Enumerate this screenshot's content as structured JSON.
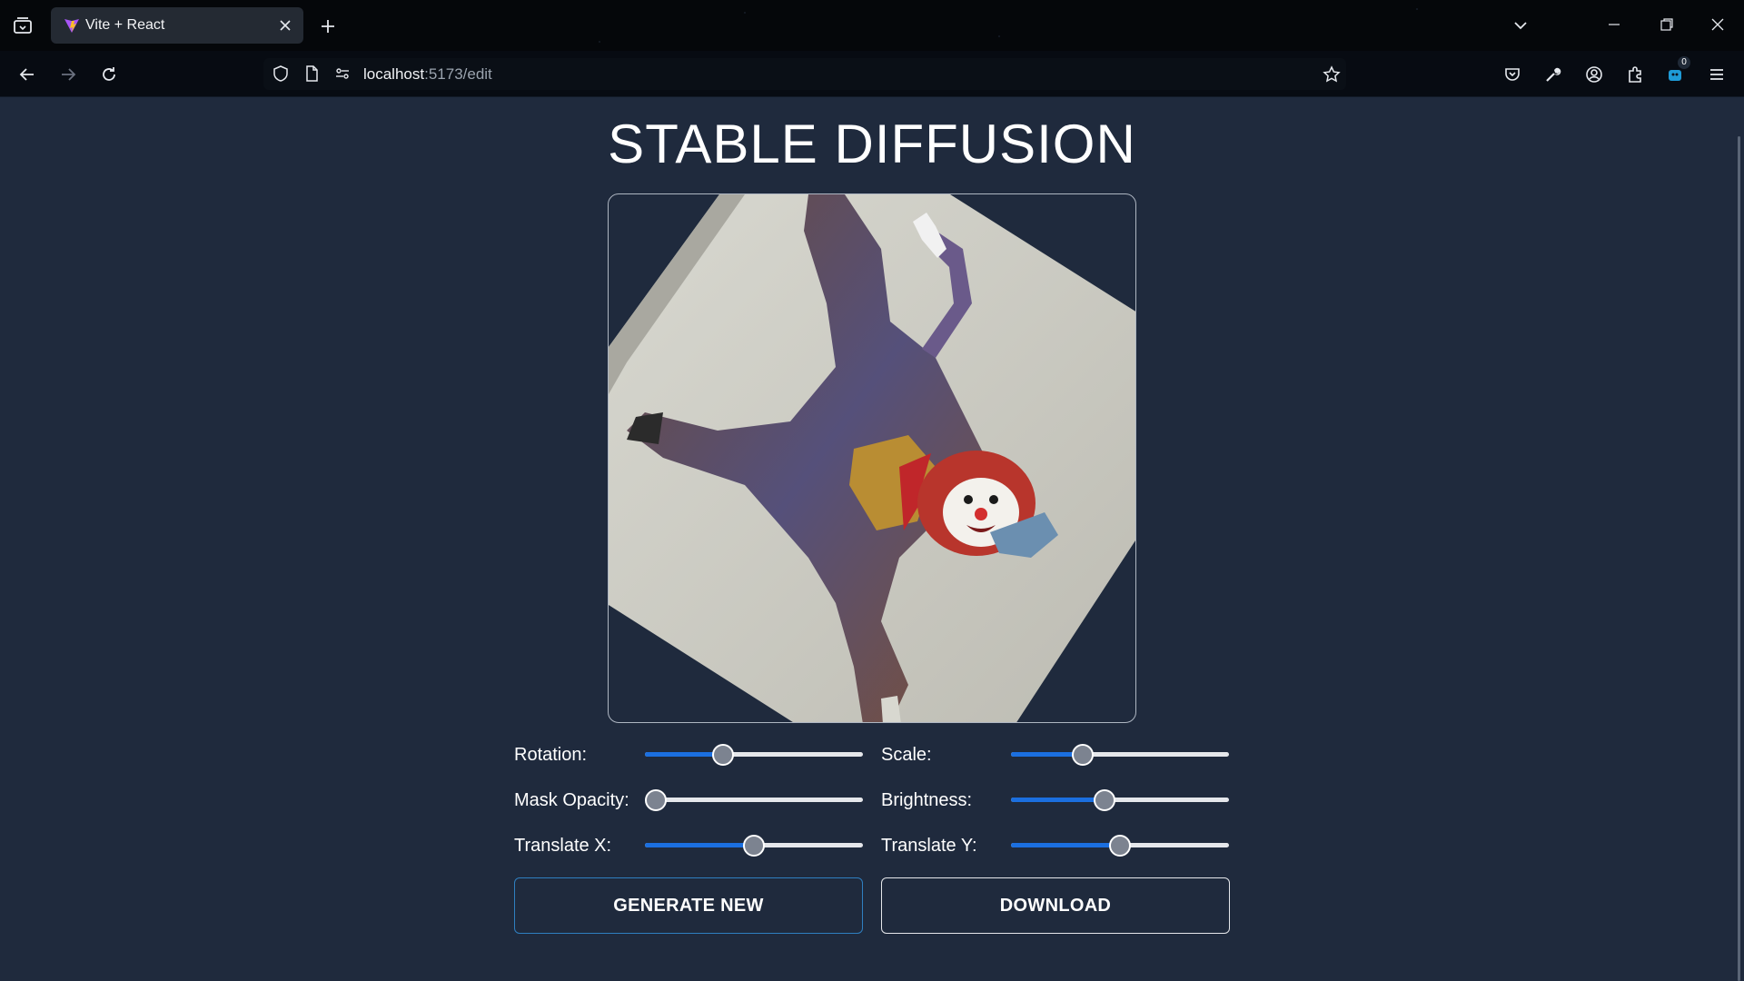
{
  "browser": {
    "tab": {
      "title": "Vite + React"
    },
    "url": {
      "host": "localhost",
      "rest": ":5173/edit"
    },
    "extension_badge": "0",
    "icons": {
      "tab_list": "tab-list-icon",
      "new_tab": "plus-icon",
      "back": "arrow-left-icon",
      "forward": "arrow-right-icon",
      "reload": "reload-icon",
      "shield": "shield-icon",
      "page": "page-icon",
      "permissions": "permissions-icon",
      "bookmark": "star-icon",
      "pocket": "pocket-icon",
      "tools": "wrench-icon",
      "account": "account-icon",
      "extensions": "puzzle-icon",
      "menu": "hamburger-icon"
    }
  },
  "page": {
    "title": "STABLE DIFFUSION",
    "image_alt": "clown-image"
  },
  "controls": {
    "rotation": {
      "label": "Rotation:",
      "value": 0.36
    },
    "scale": {
      "label": "Scale:",
      "value": 0.33
    },
    "mask_opacity": {
      "label": "Mask Opacity:",
      "value": 0.05
    },
    "brightness": {
      "label": "Brightness:",
      "value": 0.43
    },
    "translate_x": {
      "label": "Translate X:",
      "value": 0.5
    },
    "translate_y": {
      "label": "Translate Y:",
      "value": 0.5
    }
  },
  "buttons": {
    "generate": "GENERATE NEW",
    "download": "DOWNLOAD"
  },
  "colors": {
    "page_bg": "#1f2a3d",
    "slider_fill": "#1b6fe0",
    "generate_border": "#2f7fc0"
  }
}
